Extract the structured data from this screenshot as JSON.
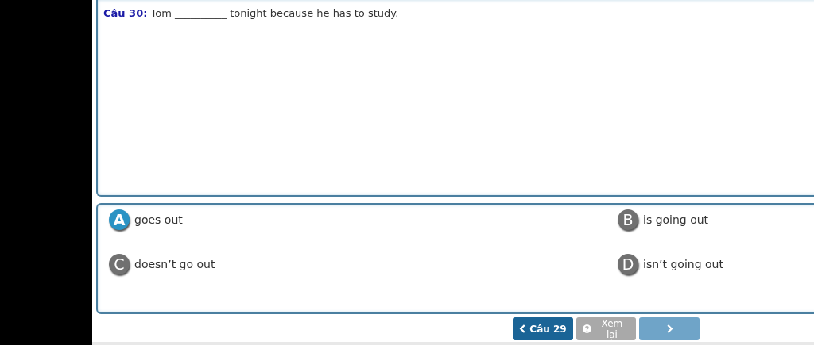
{
  "question": {
    "label": "Câu 30:",
    "text": "Tom __________ tonight because he has to study."
  },
  "options": [
    {
      "letter": "A",
      "text": "goes out",
      "selected": true
    },
    {
      "letter": "B",
      "text": "is going out",
      "selected": false
    },
    {
      "letter": "C",
      "text": "doesn’t go out",
      "selected": false
    },
    {
      "letter": "D",
      "text": "isn’t going out",
      "selected": false
    }
  ],
  "buttons": [
    {
      "kind": "prev",
      "label": "Câu 29",
      "disabled": false
    },
    {
      "kind": "review",
      "label": "Xem lại",
      "disabled": true
    },
    {
      "kind": "next",
      "disabled": true
    }
  ]
}
